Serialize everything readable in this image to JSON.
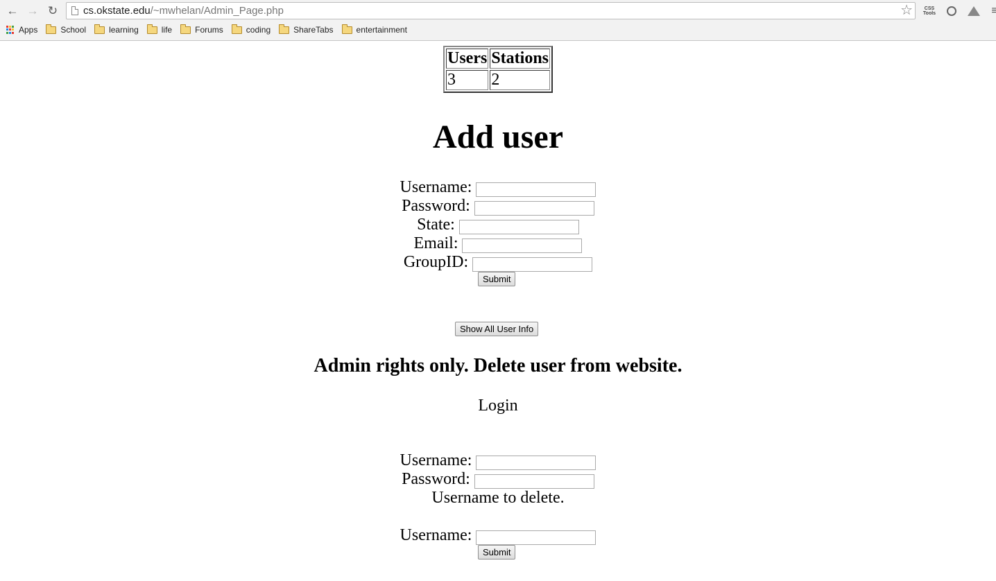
{
  "browser": {
    "url_host": "cs.okstate.edu",
    "url_path": "/~mwhelan/Admin_Page.php",
    "bookmarks": [
      "Apps",
      "School",
      "learning",
      "life",
      "Forums",
      "coding",
      "ShareTabs",
      "entertainment"
    ],
    "extensions": [
      "css-tools-icon",
      "compass-icon",
      "drive-icon"
    ]
  },
  "stats_table": {
    "headers": [
      "Users",
      "Stations"
    ],
    "values": [
      "3",
      "2"
    ]
  },
  "add_user": {
    "title": "Add user",
    "fields": [
      {
        "label": "Username:",
        "value": ""
      },
      {
        "label": "Password:",
        "value": ""
      },
      {
        "label": "State:",
        "value": ""
      },
      {
        "label": "Email:",
        "value": ""
      },
      {
        "label": "GroupID:",
        "value": ""
      }
    ],
    "submit_label": "Submit"
  },
  "show_all_label": "Show All User Info",
  "delete_user": {
    "title": "Admin rights only. Delete user from website.",
    "login_label": "Login",
    "username_label": "Username:",
    "password_label": "Password:",
    "delete_prompt": "Username to delete.",
    "delete_username_label": "Username:",
    "submit_label": "Submit"
  }
}
